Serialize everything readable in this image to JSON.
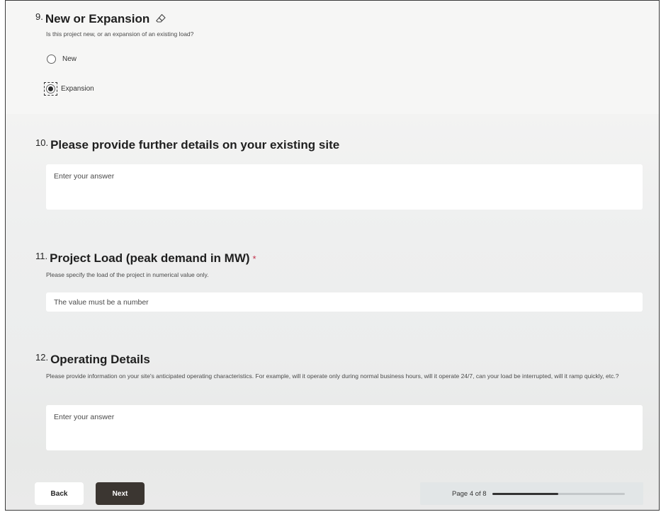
{
  "questions": [
    {
      "number": "9.",
      "title": "New or Expansion",
      "description": "Is this project new, or an expansion of an existing load?",
      "options": [
        {
          "label": "New",
          "selected": false
        },
        {
          "label": "Expansion",
          "selected": true
        }
      ]
    },
    {
      "number": "10.",
      "title": "Please provide further details on your existing site",
      "placeholder": "Enter your answer"
    },
    {
      "number": "11.",
      "title": "Project Load (peak demand in MW)",
      "required_mark": "*",
      "description": "Please specify the load of the project in numerical value only.",
      "placeholder": "The value must be a number"
    },
    {
      "number": "12.",
      "title": "Operating Details",
      "description": "Please provide information on your site's anticipated operating characteristics. For example, will it operate only during normal business hours, will it operate 24/7, can your load be interrupted, will it ramp quickly, etc.?",
      "placeholder": "Enter your answer"
    }
  ],
  "footer": {
    "back_label": "Back",
    "next_label": "Next",
    "page_text": "Page 4 of 8",
    "progress": 0.5
  },
  "colors": {
    "next_button": "#3b3631",
    "required": "#c4314b",
    "progress_fill": "#333333"
  },
  "icons": {
    "eraser": "eraser-icon"
  }
}
